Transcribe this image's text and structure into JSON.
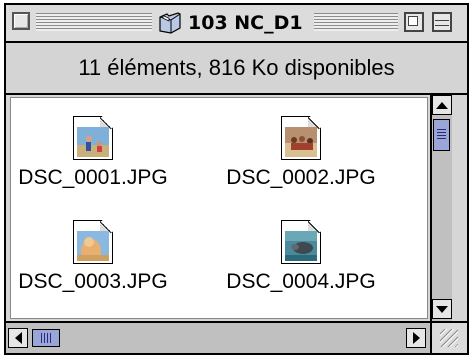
{
  "window": {
    "title": "103 NC_D1"
  },
  "header": {
    "info": "11 éléments, 816  Ko disponibles"
  },
  "files": [
    {
      "name": "DSC_0001.JPG"
    },
    {
      "name": "DSC_0002.JPG"
    },
    {
      "name": "DSC_0003.JPG"
    },
    {
      "name": "DSC_0004.JPG"
    }
  ],
  "icons": {
    "close": "close-box-icon",
    "folder": "folder-icon",
    "zoom": "zoom-box-icon",
    "collapse": "collapse-box-icon",
    "file": "jpeg-document-icon",
    "grow": "resize-grip-icon"
  },
  "colors": {
    "scroll_thumb": "#9aa6d8"
  }
}
